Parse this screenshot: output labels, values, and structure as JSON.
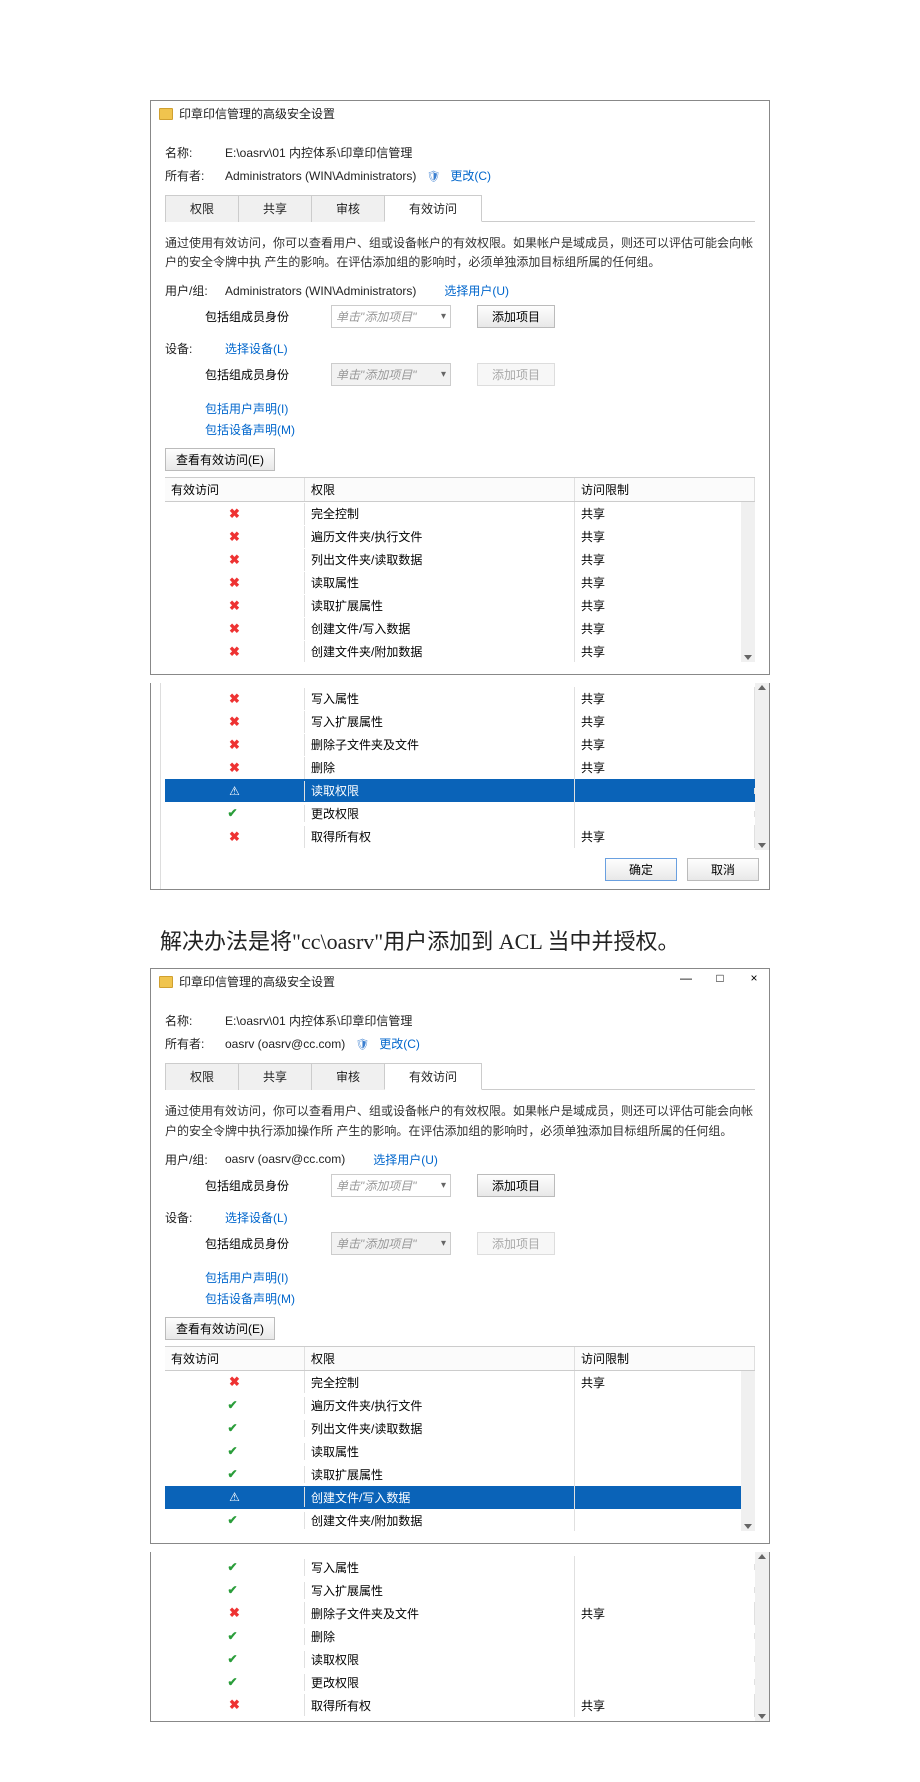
{
  "dlg1": {
    "title": "印章印信管理的高级安全设置",
    "name_label": "名称:",
    "name_value": "E:\\oasrv\\01 内控体系\\印章印信管理",
    "owner_label": "所有者:",
    "owner_value": "Administrators (WIN\\Administrators)",
    "change_link": "更改(C)",
    "tabs": [
      "权限",
      "共享",
      "审核",
      "有效访问"
    ],
    "active_tab_index": 3,
    "description": "通过使用有效访问，你可以查看用户、组或设备帐户的有效权限。如果帐户是域成员，则还可以评估可能会向帐户的安全令牌中执\n产生的影响。在评估添加组的影响时，必须单独添加目标组所属的任何组。",
    "user_label": "用户/组:",
    "user_value": "Administrators (WIN\\Administrators)",
    "select_user_link": "选择用户(U)",
    "include_member_label": "包括组成员身份",
    "add_item_placeholder": "单击\"添加项目\"",
    "add_item_btn": "添加项目",
    "device_label": "设备:",
    "select_device_link": "选择设备(L)",
    "include_user_claim_link": "包括用户声明(I)",
    "include_device_claim_link": "包括设备声明(M)",
    "view_btn": "查看有效访问(E)",
    "headers": {
      "access": "有效访问",
      "perm": "权限",
      "limit": "访问限制"
    },
    "rows": [
      {
        "icon": "deny",
        "perm": "完全控制",
        "limit": "共享"
      },
      {
        "icon": "deny",
        "perm": "遍历文件夹/执行文件",
        "limit": "共享"
      },
      {
        "icon": "deny",
        "perm": "列出文件夹/读取数据",
        "limit": "共享"
      },
      {
        "icon": "deny",
        "perm": "读取属性",
        "limit": "共享"
      },
      {
        "icon": "deny",
        "perm": "读取扩展属性",
        "limit": "共享"
      },
      {
        "icon": "deny",
        "perm": "创建文件/写入数据",
        "limit": "共享"
      },
      {
        "icon": "deny",
        "perm": "创建文件夹/附加数据",
        "limit": "共享"
      },
      {
        "icon": "deny",
        "perm": "写入属性",
        "limit": "共享"
      }
    ]
  },
  "dlg1b": {
    "rows": [
      {
        "icon": "deny",
        "perm": "写入属性",
        "limit": "共享"
      },
      {
        "icon": "deny",
        "perm": "写入扩展属性",
        "limit": "共享"
      },
      {
        "icon": "deny",
        "perm": "删除子文件夹及文件",
        "limit": "共享"
      },
      {
        "icon": "deny",
        "perm": "删除",
        "limit": "共享"
      },
      {
        "icon": "warn",
        "perm": "读取权限",
        "limit": "",
        "selected": true
      },
      {
        "icon": "allow",
        "perm": "更改权限",
        "limit": ""
      },
      {
        "icon": "deny",
        "perm": "取得所有权",
        "limit": "共享"
      }
    ],
    "ok_btn": "确定",
    "cancel_btn": "取消"
  },
  "annotation": "解决办法是将\"cc\\oasrv\"用户添加到 ACL 当中并授权。",
  "dlg2": {
    "title": "印章印信管理的高级安全设置",
    "name_label": "名称:",
    "name_value": "E:\\oasrv\\01 内控体系\\印章印信管理",
    "owner_label": "所有者:",
    "owner_value": "oasrv (oasrv@cc.com)",
    "change_link": "更改(C)",
    "tabs": [
      "权限",
      "共享",
      "审核",
      "有效访问"
    ],
    "active_tab_index": 3,
    "description": "通过使用有效访问，你可以查看用户、组或设备帐户的有效权限。如果帐户是域成员，则还可以评估可能会向帐户的安全令牌中执行添加操作所\n产生的影响。在评估添加组的影响时，必须单独添加目标组所属的任何组。",
    "user_label": "用户/组:",
    "user_value": "oasrv (oasrv@cc.com)",
    "select_user_link": "选择用户(U)",
    "include_member_label": "包括组成员身份",
    "add_item_placeholder": "单击\"添加项目\"",
    "add_item_btn": "添加项目",
    "device_label": "设备:",
    "select_device_link": "选择设备(L)",
    "include_user_claim_link": "包括用户声明(I)",
    "include_device_claim_link": "包括设备声明(M)",
    "view_btn": "查看有效访问(E)",
    "headers": {
      "access": "有效访问",
      "perm": "权限",
      "limit": "访问限制"
    },
    "rows": [
      {
        "icon": "deny",
        "perm": "完全控制",
        "limit": "共享"
      },
      {
        "icon": "allow",
        "perm": "遍历文件夹/执行文件",
        "limit": ""
      },
      {
        "icon": "allow",
        "perm": "列出文件夹/读取数据",
        "limit": ""
      },
      {
        "icon": "allow",
        "perm": "读取属性",
        "limit": ""
      },
      {
        "icon": "allow",
        "perm": "读取扩展属性",
        "limit": ""
      },
      {
        "icon": "warn",
        "perm": "创建文件/写入数据",
        "limit": "",
        "selected": true
      },
      {
        "icon": "allow",
        "perm": "创建文件夹/附加数据",
        "limit": ""
      },
      {
        "icon": "allow",
        "perm": "写入属性",
        "limit": ""
      }
    ]
  },
  "dlg2b": {
    "rows": [
      {
        "icon": "allow",
        "perm": "写入属性",
        "limit": ""
      },
      {
        "icon": "allow",
        "perm": "写入扩展属性",
        "limit": ""
      },
      {
        "icon": "deny",
        "perm": "删除子文件夹及文件",
        "limit": "共享"
      },
      {
        "icon": "allow",
        "perm": "删除",
        "limit": ""
      },
      {
        "icon": "allow",
        "perm": "读取权限",
        "limit": ""
      },
      {
        "icon": "allow",
        "perm": "更改权限",
        "limit": ""
      },
      {
        "icon": "deny",
        "perm": "取得所有权",
        "limit": "共享"
      }
    ]
  },
  "winctrl": {
    "min": "—",
    "max": "□",
    "close": "×"
  }
}
